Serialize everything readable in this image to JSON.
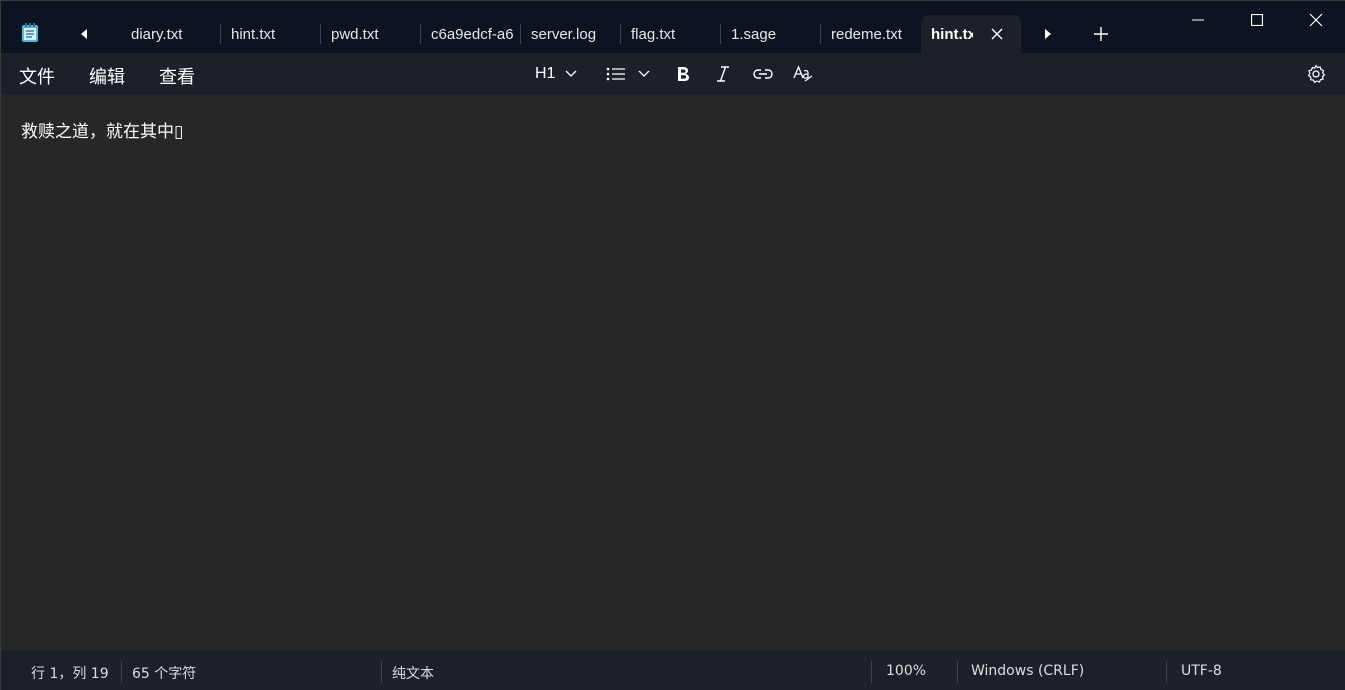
{
  "window": {
    "app_icon": "notepad-icon",
    "colors": {
      "titlebar": "#0d1421",
      "toolbar": "#1c2028",
      "editor": "#272727",
      "text": "#ffffff"
    }
  },
  "tabs": [
    {
      "label": "diary.txt",
      "active": false
    },
    {
      "label": "hint.txt",
      "active": false
    },
    {
      "label": "pwd.txt",
      "active": false
    },
    {
      "label": "c6a9edcf-a6",
      "active": false
    },
    {
      "label": "server.log",
      "active": false
    },
    {
      "label": "flag.txt",
      "active": false
    },
    {
      "label": "1.sage",
      "active": false
    },
    {
      "label": "redeme.txt",
      "active": false
    },
    {
      "label": "hint.tx",
      "active": true
    }
  ],
  "menu": {
    "file": "文件",
    "edit": "编辑",
    "view": "查看"
  },
  "toolbar": {
    "heading_label": "H1",
    "icons": [
      "chevron-down-icon",
      "list-icon",
      "bold-icon",
      "italic-icon",
      "link-icon",
      "clear-format-icon",
      "settings-icon"
    ]
  },
  "editor": {
    "content": "救赎之道，就在其中▯"
  },
  "status": {
    "position": "行 1，列 19",
    "chars": "65 个字符",
    "format": "纯文本",
    "zoom": "100%",
    "line_ending": "Windows (CRLF)",
    "encoding": "UTF-8"
  }
}
